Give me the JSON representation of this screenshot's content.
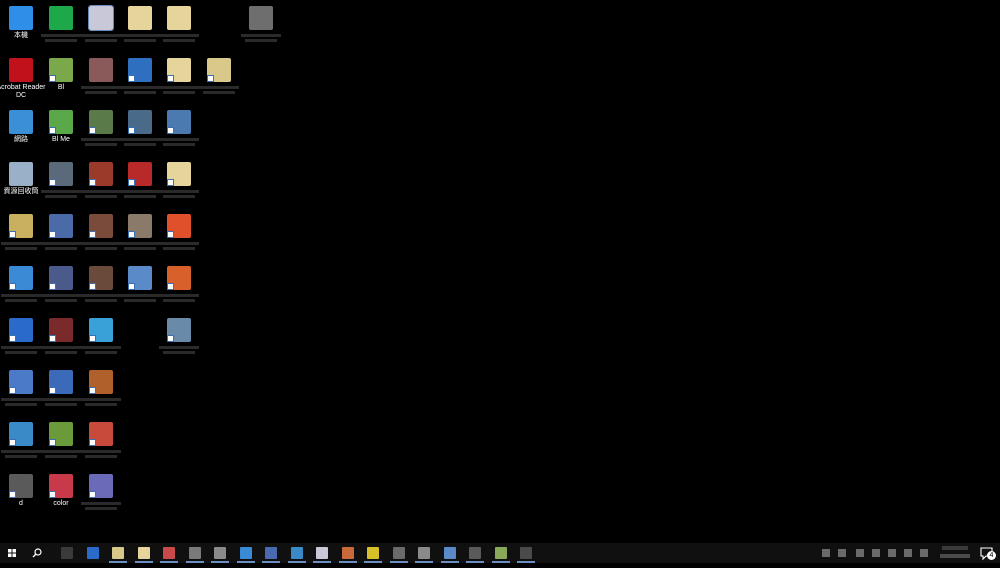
{
  "desktop": {
    "icons": [
      {
        "label": "本機",
        "color": "#2f8fe8"
      },
      {
        "label": "",
        "color": "#1da94a"
      },
      {
        "label": "",
        "color": "#c8c8d8"
      },
      {
        "label": "",
        "color": "#e6d59a"
      },
      {
        "label": "",
        "color": "#e6d59a"
      },
      {
        "label": "",
        "color": "#6e6e6e"
      },
      {
        "label": "Acrobat Reader DC",
        "color": "#c1121c"
      },
      {
        "label": "Bl",
        "color": "#7aa84a"
      },
      {
        "label": "",
        "color": "#8a5a5a"
      },
      {
        "label": "",
        "color": "#2f6fbf"
      },
      {
        "label": "",
        "color": "#e6d59a"
      },
      {
        "label": "",
        "color": "#d8c88a"
      },
      {
        "label": "網路",
        "color": "#3a8fd6"
      },
      {
        "label": "Bl Me",
        "color": "#5aa84a"
      },
      {
        "label": "",
        "color": "#5a7a4a"
      },
      {
        "label": "",
        "color": "#4a6a8a"
      },
      {
        "label": "",
        "color": "#4a7ab0"
      },
      {
        "label": "資源回收筒",
        "color": "#9ab0c8"
      },
      {
        "label": "",
        "color": "#5a6a7a"
      },
      {
        "label": "",
        "color": "#9a3a2a"
      },
      {
        "label": "",
        "color": "#b82a2a"
      },
      {
        "label": "",
        "color": "#e6d59a"
      },
      {
        "label": "",
        "color": "#c8b060"
      },
      {
        "label": "",
        "color": "#4a6aa8"
      },
      {
        "label": "",
        "color": "#7a4a3a"
      },
      {
        "label": "",
        "color": "#8a7a6a"
      },
      {
        "label": "",
        "color": "#e0502a"
      },
      {
        "label": "",
        "color": "#3a8ad6"
      },
      {
        "label": "",
        "color": "#4a5a8a"
      },
      {
        "label": "",
        "color": "#6a4a3a"
      },
      {
        "label": "",
        "color": "#5a8ac8"
      },
      {
        "label": "",
        "color": "#d8602a"
      },
      {
        "label": "",
        "color": "#2a6ac8"
      },
      {
        "label": "",
        "color": "#7a2a2a"
      },
      {
        "label": "",
        "color": "#3aa0d8"
      },
      {
        "label": "",
        "color": "#6a8aaa"
      },
      {
        "label": "",
        "color": "#4a7ac8"
      },
      {
        "label": "",
        "color": "#3a6ab8"
      },
      {
        "label": "",
        "color": "#b0602a"
      },
      {
        "label": "",
        "color": "#3a8ac8"
      },
      {
        "label": "",
        "color": "#6a9a3a"
      },
      {
        "label": "",
        "color": "#c84a3a"
      },
      {
        "label": "d",
        "color": "#5a5a5a"
      },
      {
        "label": "color",
        "color": "#c83a4a"
      },
      {
        "label": "",
        "color": "#6a6ab8"
      }
    ]
  },
  "taskbar": {
    "start_icon": "windows-logo-icon",
    "search_icon": "search-icon",
    "apps": [
      {
        "color": "#3a3a3a"
      },
      {
        "color": "#2a6ac8"
      },
      {
        "color": "#d8c88a"
      },
      {
        "color": "#e6d59a"
      },
      {
        "color": "#c84a4a"
      },
      {
        "color": "#7a7a7a"
      },
      {
        "color": "#8a8a8a"
      },
      {
        "color": "#3a8ad6"
      },
      {
        "color": "#4a6ab0"
      },
      {
        "color": "#3a8ac8"
      },
      {
        "color": "#c8c8d8"
      },
      {
        "color": "#c86a3a"
      },
      {
        "color": "#d8c02a"
      },
      {
        "color": "#6a6a6a"
      },
      {
        "color": "#8a8a8a"
      },
      {
        "color": "#5a8ac8"
      },
      {
        "color": "#5a5a5a"
      },
      {
        "color": "#8aa85a"
      },
      {
        "color": "#4a4a4a"
      }
    ],
    "notification_count": "4"
  }
}
